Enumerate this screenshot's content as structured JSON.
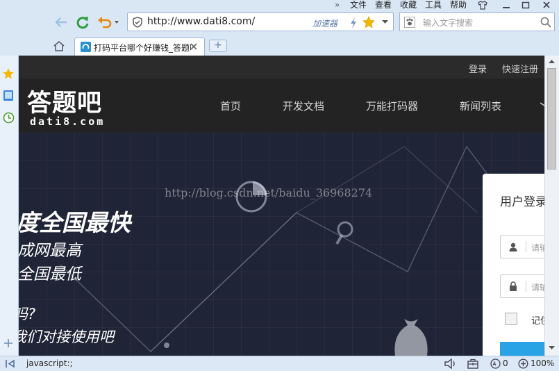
{
  "menu": {
    "chevron": "»",
    "items": [
      "文件",
      "查看",
      "收藏",
      "工具",
      "帮助"
    ]
  },
  "toolbar": {
    "url": "http://www.dati8.com/",
    "accelerator_label": "加速器",
    "search_placeholder": "输入文字搜索"
  },
  "tabs": [
    {
      "title": "打码平台哪个好赚钱_答题吧"
    }
  ],
  "newtab_label": "+",
  "site": {
    "top_links": [
      "登录",
      "快速注册"
    ],
    "logo_cn": "答题吧",
    "logo_en": "dati8.com",
    "nav": [
      "首页",
      "开发文档",
      "万能打码器",
      "新闻列表"
    ],
    "watermark": "http://blog.csdn.net/baidu_36968274",
    "hero_lines": [
      "度全国最快",
      "成网最高",
      "全国最低",
      "吗?",
      "我们对接使用吧"
    ],
    "login": {
      "title": "用户登录",
      "username_placeholder": "请输入用户名",
      "password_placeholder": "请输入密码",
      "remember_label": "记住"
    }
  },
  "status": {
    "text": "javascript:;",
    "badge_count": "0",
    "zoom": "100%"
  },
  "colors": {
    "accent": "#2aa3e6",
    "nav_bg": "#232323",
    "hero_bg": "#1f2436",
    "browser_chrome": "#d9e7f5"
  }
}
